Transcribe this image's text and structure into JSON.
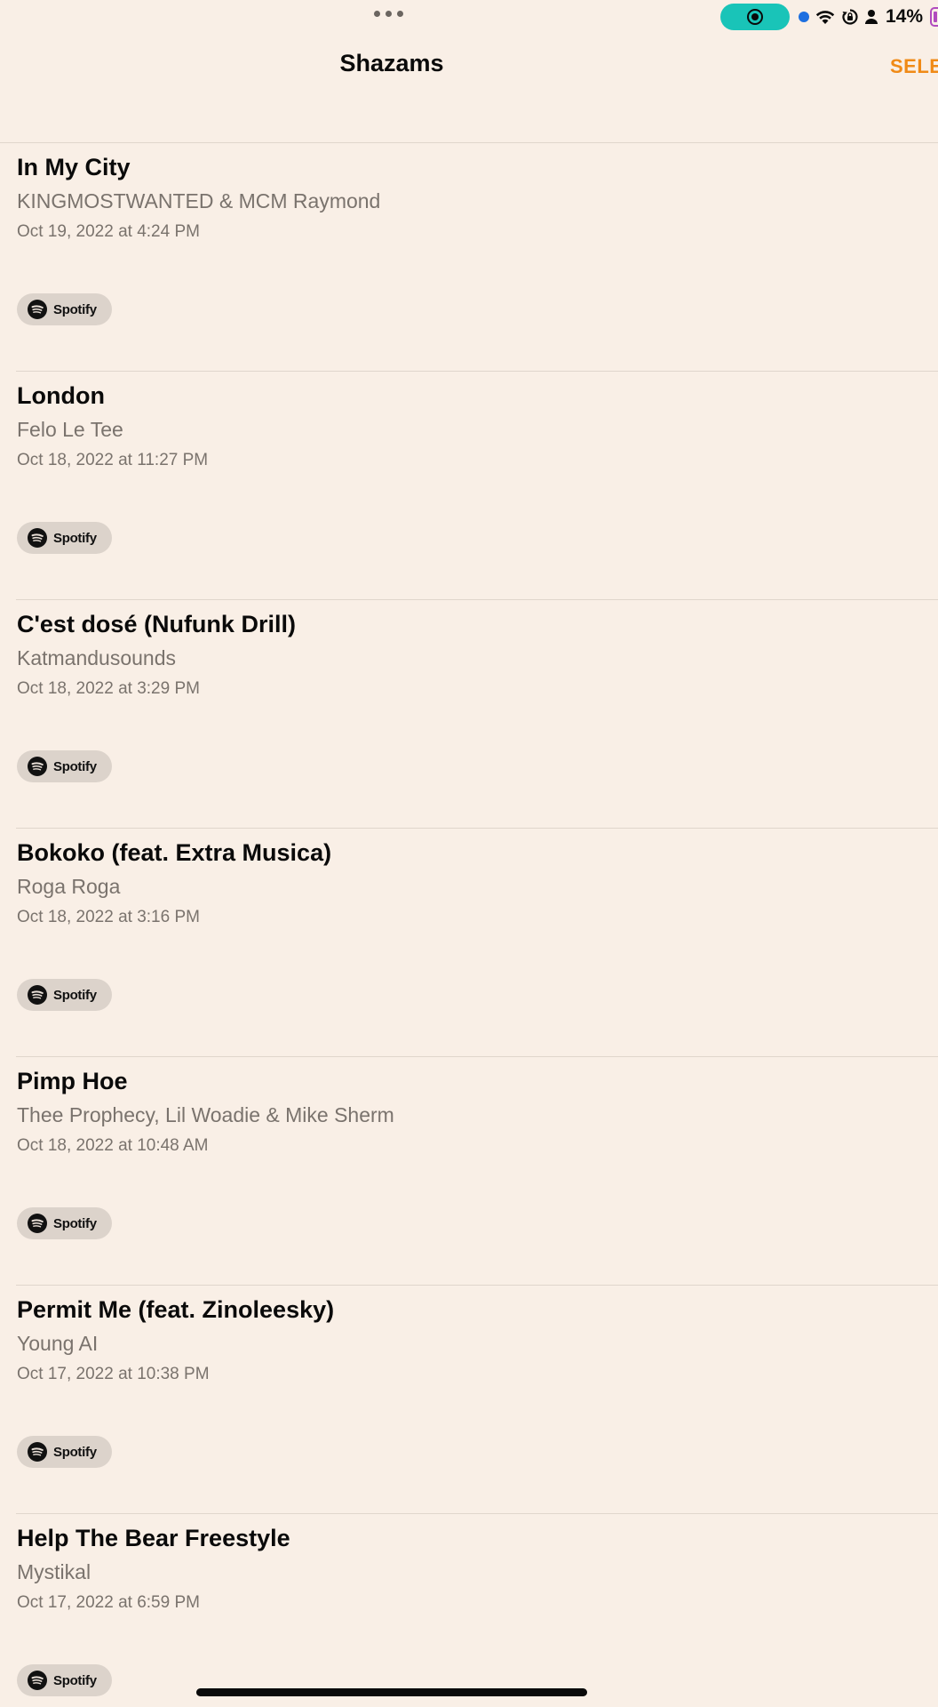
{
  "status_bar": {
    "battery_percent": "14%",
    "battery_level": 0.14,
    "colors": {
      "record_pill": "#19c4b8",
      "mic_dot": "#1d6fe0",
      "battery": "#b04bbf"
    },
    "icons": [
      "more-dots-icon",
      "screen-record-icon",
      "mic-indicator-icon",
      "wifi-icon",
      "orientation-lock-icon",
      "person-icon",
      "battery-icon"
    ]
  },
  "nav": {
    "title": "Shazams",
    "select_label": "SELE",
    "accent_color": "#f08a16"
  },
  "shazams": [
    {
      "title": "In My City",
      "artist": "KINGMOSTWANTED & MCM Raymond",
      "date": "Oct 19, 2022 at 4:24 PM",
      "service": "Spotify"
    },
    {
      "title": "London",
      "artist": "Felo Le Tee",
      "date": "Oct 18, 2022 at 11:27 PM",
      "service": "Spotify"
    },
    {
      "title": "C'est dosé (Nufunk Drill)",
      "artist": "Katmandusounds",
      "date": "Oct 18, 2022 at 3:29 PM",
      "service": "Spotify"
    },
    {
      "title": "Bokoko (feat. Extra Musica)",
      "artist": "Roga Roga",
      "date": "Oct 18, 2022 at 3:16 PM",
      "service": "Spotify"
    },
    {
      "title": "Pimp Hoe",
      "artist": "Thee Prophecy, Lil Woadie & Mike Sherm",
      "date": "Oct 18, 2022 at 10:48 AM",
      "service": "Spotify"
    },
    {
      "title": "Permit Me (feat. Zinoleesky)",
      "artist": "Young AI",
      "date": "Oct 17, 2022 at 10:38 PM",
      "service": "Spotify"
    },
    {
      "title": "Help The Bear Freestyle",
      "artist": "Mystikal",
      "date": "Oct 17, 2022 at 6:59 PM",
      "service": "Spotify"
    }
  ]
}
